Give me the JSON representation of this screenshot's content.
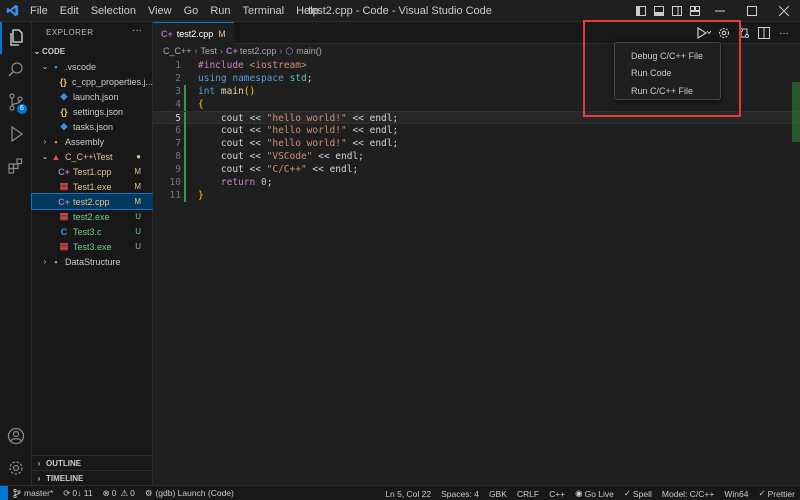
{
  "menu": [
    "File",
    "Edit",
    "Selection",
    "View",
    "Go",
    "Run",
    "Terminal",
    "Help"
  ],
  "window_title": "test2.cpp - Code - Visual Studio Code",
  "activity": {
    "scm_badge": "6"
  },
  "sidebar": {
    "header": "EXPLORER",
    "more": "···",
    "root": "CODE",
    "items": [
      {
        "label": ".vscode",
        "icon": "vscode-folder-icon",
        "glyph": "▪",
        "color": "#3b8eea",
        "chev": "⌄",
        "status": "",
        "indent": 1
      },
      {
        "label": "c_cpp_properties.j...",
        "icon": "json-icon",
        "glyph": "{}",
        "color": "#e8c56b",
        "chev": "",
        "status": "",
        "indent": 2
      },
      {
        "label": "launch.json",
        "icon": "vscode-file-icon",
        "glyph": "◆",
        "color": "#3b8eea",
        "chev": "",
        "status": "",
        "indent": 2
      },
      {
        "label": "settings.json",
        "icon": "json-icon",
        "glyph": "{}",
        "color": "#e8c56b",
        "chev": "",
        "status": "",
        "indent": 2
      },
      {
        "label": "tasks.json",
        "icon": "vscode-file-icon",
        "glyph": "◆",
        "color": "#3b8eea",
        "chev": "",
        "status": "",
        "indent": 2
      },
      {
        "label": "Assembly",
        "icon": "folder-icon",
        "glyph": "▪",
        "color": "#c09553",
        "chev": "›",
        "status": "",
        "indent": 1
      },
      {
        "label": "C_C++\\Test",
        "icon": "cpp-folder-icon",
        "glyph": "▲",
        "color": "#e05252",
        "chev": "⌄",
        "status": "●",
        "indent": 1
      },
      {
        "label": "Test1.cpp",
        "icon": "cpp-file-icon",
        "glyph": "C+",
        "color": "#a074c4",
        "chev": "",
        "status": "M",
        "indent": 2
      },
      {
        "label": "Test1.exe",
        "icon": "exe-file-icon",
        "glyph": "▤",
        "color": "#e05252",
        "chev": "",
        "status": "M",
        "indent": 2
      },
      {
        "label": "test2.cpp",
        "icon": "cpp-file-icon",
        "glyph": "C+",
        "color": "#a074c4",
        "chev": "",
        "status": "M",
        "indent": 2
      },
      {
        "label": "test2.exe",
        "icon": "exe-file-icon",
        "glyph": "▤",
        "color": "#e05252",
        "chev": "",
        "status": "U",
        "indent": 2
      },
      {
        "label": "Test3.c",
        "icon": "c-file-icon",
        "glyph": "C",
        "color": "#3b8eea",
        "chev": "",
        "status": "U",
        "indent": 2
      },
      {
        "label": "Test3.exe",
        "icon": "exe-file-icon",
        "glyph": "▤",
        "color": "#e05252",
        "chev": "",
        "status": "U",
        "indent": 2
      },
      {
        "label": "DataStructure",
        "icon": "folder-icon",
        "glyph": "▪",
        "color": "#c09553",
        "chev": "›",
        "status": "",
        "indent": 1
      }
    ],
    "outline": "OUTLINE",
    "timeline": "TIMELINE"
  },
  "tab": {
    "icon_text": "C+",
    "label": "test2.cpp",
    "modified": "M"
  },
  "breadcrumb": {
    "folder": "C_C++",
    "subfolder": "Test",
    "file_icon": "C+",
    "file": "test2.cpp",
    "symbol": "main()"
  },
  "code": [
    {
      "n": "1",
      "html": "<span class=\"pp\">#include</span> <span class=\"str\">&lt;iostream&gt;</span>"
    },
    {
      "n": "2",
      "html": "<span class=\"kw\">using</span> <span class=\"kw\">namespace</span> <span class=\"ty\">std</span>;"
    },
    {
      "n": "3",
      "html": "<span class=\"kw\">int</span> <span class=\"fn\">main</span><span class=\"brk\">()</span>"
    },
    {
      "n": "4",
      "html": "<span class=\"brk\">{</span>"
    },
    {
      "n": "5",
      "html": "    cout &lt;&lt; <span class=\"str\">\"hello world!\"</span> &lt;&lt; endl;"
    },
    {
      "n": "6",
      "html": "    cout &lt;&lt; <span class=\"str\">\"hello world!\"</span> &lt;&lt; endl;"
    },
    {
      "n": "7",
      "html": "    cout &lt;&lt; <span class=\"str\">\"hello world!\"</span> &lt;&lt; endl;"
    },
    {
      "n": "8",
      "html": "    cout &lt;&lt; <span class=\"str\">\"VSCode\"</span> &lt;&lt; endl;"
    },
    {
      "n": "9",
      "html": "    cout &lt;&lt; <span class=\"str\">\"C/C++\"</span> &lt;&lt; endl;"
    },
    {
      "n": "10",
      "html": "    <span class=\"pp\">return</span> <span class=\"num\">0</span>;"
    },
    {
      "n": "11",
      "html": "<span class=\"brk\">}</span>"
    }
  ],
  "current_line": "5",
  "run_menu": [
    "Debug C/C++ File",
    "Run Code",
    "Run C/C++ File"
  ],
  "status": {
    "branch": "master*",
    "sync": "0↓ 11",
    "problems_errors": "0",
    "problems_warnings": "0",
    "launch": "(gdb) Launch (Code)",
    "position": "Ln 5, Col 22",
    "spaces": "Spaces: 4",
    "encoding": "GBK",
    "eol": "CRLF",
    "language": "C++",
    "golive": "Go Live",
    "spell": "Spell",
    "model": "Model: C/C++",
    "platform": "Win64",
    "prettier": "Prettier"
  },
  "colors": {
    "accent": "#0078d4",
    "highlight_box": "#e53935",
    "modified": "#e2c08d",
    "untracked": "#73c991"
  }
}
